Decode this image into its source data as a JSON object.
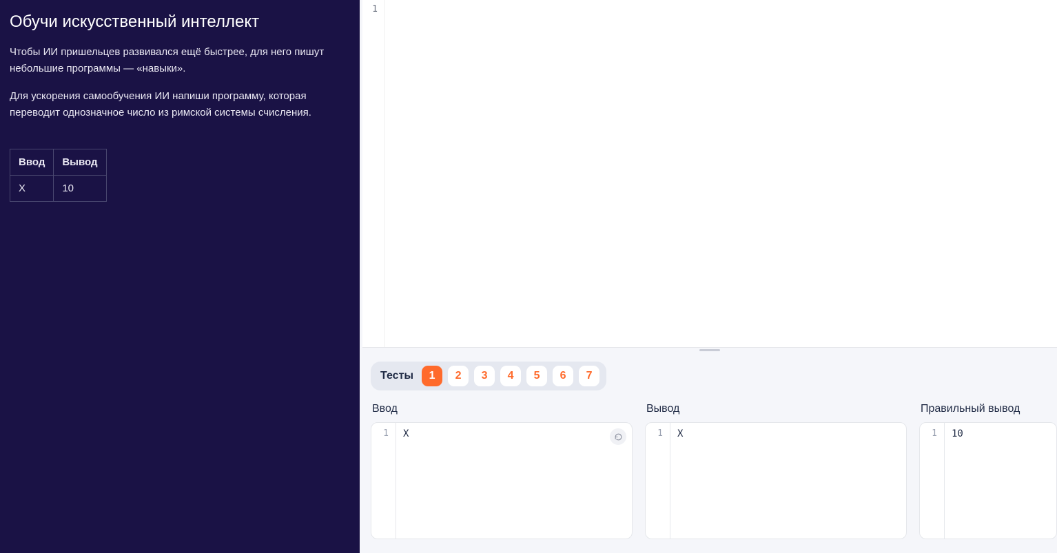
{
  "sidebar": {
    "title": "Обучи искусственный интеллект",
    "desc1": "Чтобы ИИ пришельцев развивался ещё быстрее, для него пишут небольшие программы — «навыки».",
    "desc2": "Для ускорения самообучения ИИ напиши программу, которая переводит однозначное число из римской системы счисления.",
    "table": {
      "head_input": "Ввод",
      "head_output": "Вывод",
      "row": {
        "input": "X",
        "output": "10"
      }
    }
  },
  "editor": {
    "line_numbers": [
      "1"
    ]
  },
  "tests": {
    "label": "Тесты",
    "tabs": [
      "1",
      "2",
      "3",
      "4",
      "5",
      "6",
      "7"
    ],
    "active": "1",
    "panels": {
      "input": {
        "title": "Ввод",
        "line": "1",
        "content": "X"
      },
      "output": {
        "title": "Вывод",
        "line": "1",
        "content": "X"
      },
      "correct": {
        "title": "Правильный вывод",
        "line": "1",
        "content": "10"
      }
    }
  }
}
